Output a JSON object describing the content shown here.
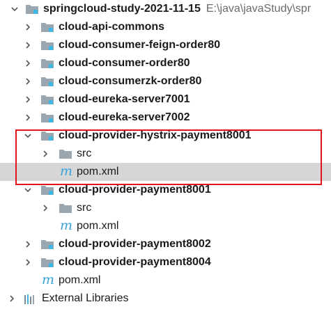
{
  "project": {
    "name": "springcloud-study-2021-11-15",
    "path": "E:\\java\\javaStudy\\spr"
  },
  "modules": [
    {
      "name": "cloud-api-commons"
    },
    {
      "name": "cloud-consumer-feign-order80"
    },
    {
      "name": "cloud-consumer-order80"
    },
    {
      "name": "cloud-consumerzk-order80"
    },
    {
      "name": "cloud-eureka-server7001"
    },
    {
      "name": "cloud-eureka-server7002"
    },
    {
      "name": "cloud-provider-hystrix-payment8001",
      "src": "src",
      "pom": "pom.xml"
    },
    {
      "name": "cloud-provider-payment8001",
      "src": "src",
      "pom": "pom.xml"
    },
    {
      "name": "cloud-provider-payment8002"
    },
    {
      "name": "cloud-provider-payment8004"
    }
  ],
  "root_pom": "pom.xml",
  "external_libraries": "External Libraries",
  "colors": {
    "selection": "#d6d6d6",
    "highlight_border": "#e0151b",
    "maven_icon": "#3aa3d9",
    "folder": "#9aa7b0",
    "module_marker": "#40b6e0"
  }
}
